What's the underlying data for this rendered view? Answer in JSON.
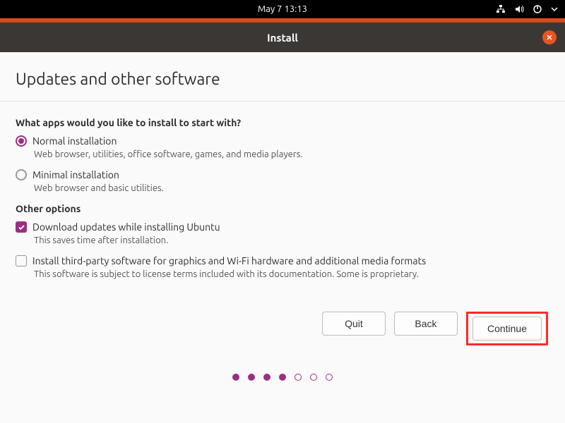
{
  "topbar": {
    "datetime": "May 7  13:13"
  },
  "window": {
    "title": "Install"
  },
  "page": {
    "title": "Updates and other software",
    "question": "What apps would you like to install to start with?",
    "normal": {
      "label": "Normal installation",
      "desc": "Web browser, utilities, office software, games, and media players.",
      "selected": true
    },
    "minimal": {
      "label": "Minimal installation",
      "desc": "Web browser and basic utilities.",
      "selected": false
    },
    "other_heading": "Other options",
    "download": {
      "label": "Download updates while installing Ubuntu",
      "desc": "This saves time after installation.",
      "checked": true
    },
    "thirdparty": {
      "label": "Install third-party software for graphics and Wi-Fi hardware and additional media formats",
      "desc": "This software is subject to license terms included with its documentation. Some is proprietary.",
      "checked": false
    }
  },
  "buttons": {
    "quit": "Quit",
    "back": "Back",
    "continue": "Continue"
  },
  "progress": {
    "current": 4,
    "total": 7
  }
}
